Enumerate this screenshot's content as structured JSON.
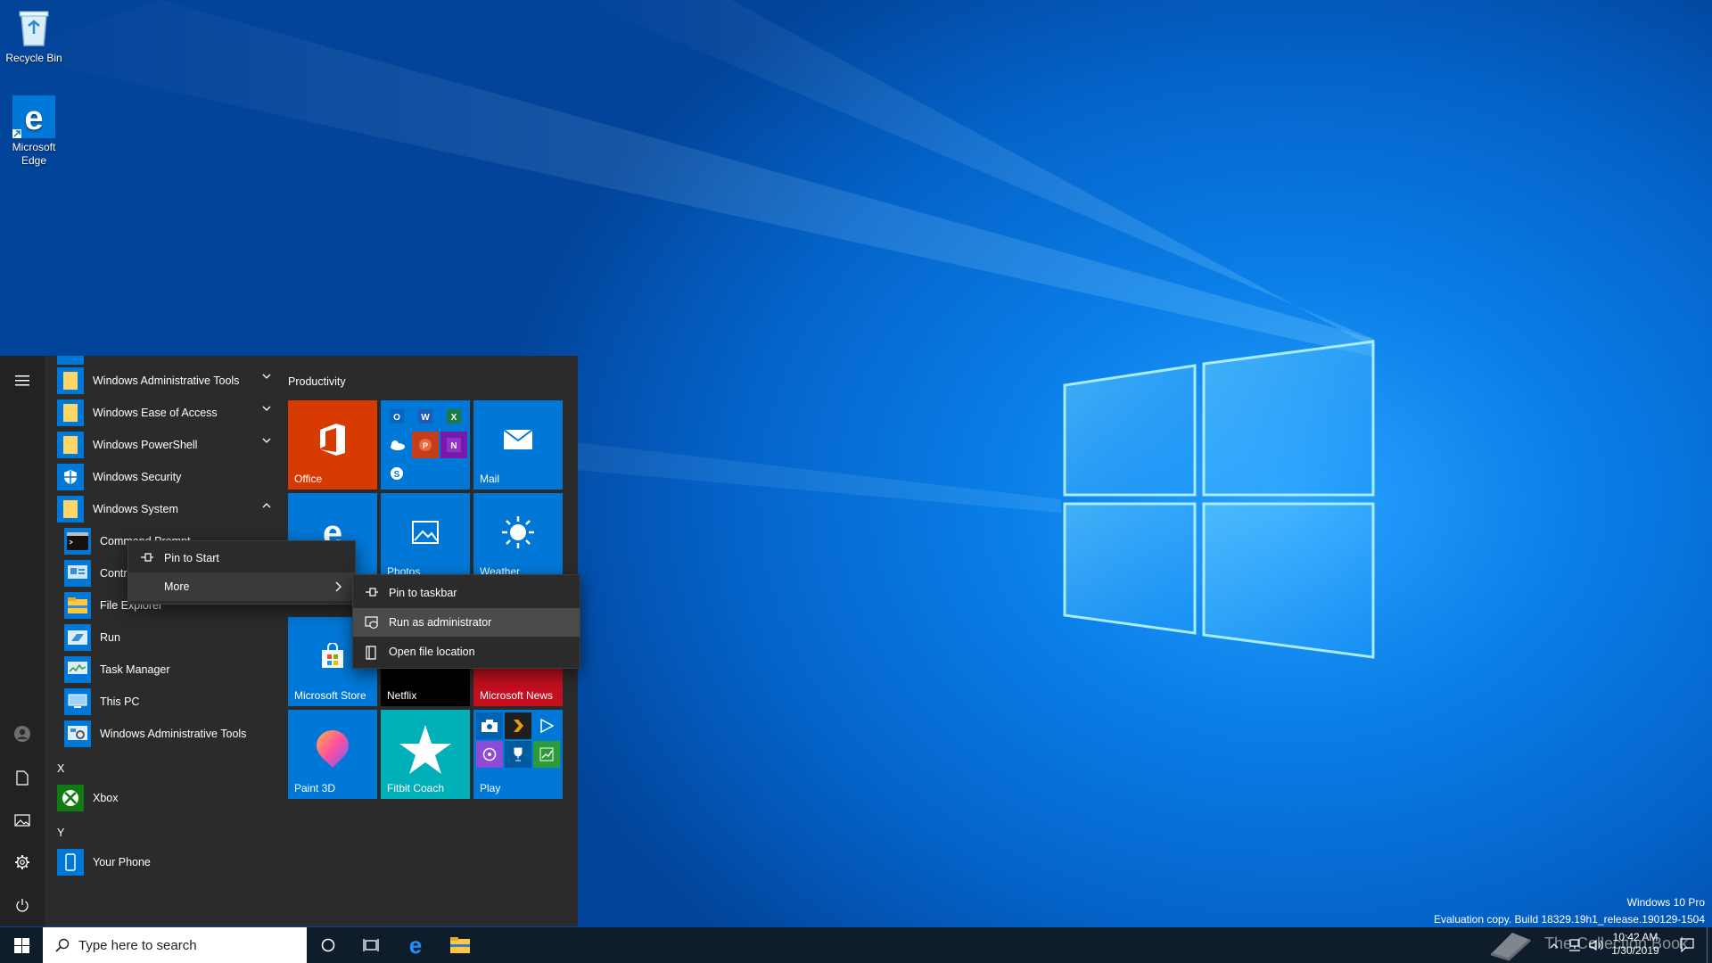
{
  "desktop": {
    "icons": [
      {
        "label": "Recycle Bin"
      },
      {
        "label": "Microsoft Edge"
      }
    ],
    "watermark": {
      "edition": "Windows 10 Pro",
      "build": "Evaluation copy. Build 18329.19h1_release.190129-1504",
      "brand": "The Collection Book"
    }
  },
  "start_menu": {
    "apps": [
      {
        "label": "Windows Administrative Tools",
        "expandable": true
      },
      {
        "label": "Windows Ease of Access",
        "expandable": true
      },
      {
        "label": "Windows PowerShell",
        "expandable": true
      },
      {
        "label": "Windows Security"
      },
      {
        "label": "Windows System",
        "expanded": true
      },
      {
        "label": "Command Prompt"
      },
      {
        "label": "Control Panel"
      },
      {
        "label": "File Explorer"
      },
      {
        "label": "Run"
      },
      {
        "label": "Task Manager"
      },
      {
        "label": "This PC"
      },
      {
        "label": "Windows Administrative Tools"
      },
      {
        "label": "Xbox"
      },
      {
        "label": "Your Phone"
      }
    ],
    "letters": {
      "x": "X",
      "y": "Y"
    },
    "group_title": "Productivity",
    "tiles": {
      "office": "Office",
      "mail": "Mail",
      "edge": "Microsoft Edge",
      "photos": "Photos",
      "weather": "Weather",
      "store": "Microsoft Store",
      "netflix": "Netflix",
      "news": "Microsoft News",
      "paint3d": "Paint 3D",
      "fitbit": "Fitbit Coach",
      "play": "Play"
    }
  },
  "context_menu": {
    "pin_to_start": "Pin to Start",
    "more": "More"
  },
  "more_submenu": {
    "pin_to_taskbar": "Pin to taskbar",
    "run_as_admin": "Run as administrator",
    "open_file_location": "Open file location"
  },
  "taskbar": {
    "search_placeholder": "Type here to search",
    "time": "10:42 AM",
    "date": "1/30/2019"
  },
  "colors": {
    "accent": "#0078d7",
    "office": "#d83b01",
    "news": "#c50f1f",
    "fitbit": "#00b0b9",
    "menu_bg": "#2b2b2b",
    "taskbar": "#0f1c2b"
  }
}
